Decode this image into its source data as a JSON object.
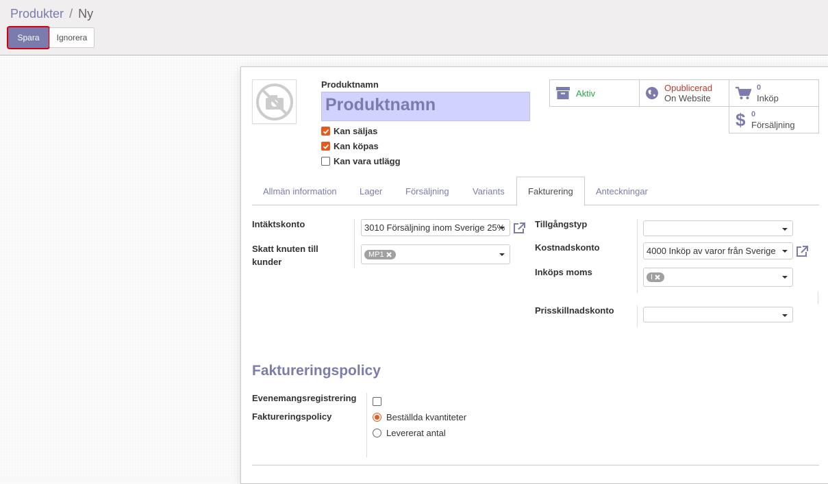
{
  "breadcrumb": {
    "parent": "Produkter",
    "separator": "/",
    "current": "Ny"
  },
  "toolbar": {
    "save_label": "Spara",
    "discard_label": "Ignorera"
  },
  "product": {
    "name_label": "Produktnamn",
    "name_placeholder": "Produktnamn",
    "checks": [
      {
        "label": "Kan säljas",
        "checked": true
      },
      {
        "label": "Kan köpas",
        "checked": true
      },
      {
        "label": "Kan vara utlägg",
        "checked": false
      }
    ]
  },
  "stat_buttons": {
    "active": {
      "label": "Aktiv",
      "icon": "archive-icon",
      "color": "#28a745"
    },
    "website": {
      "line1": "Opublicerad",
      "line2": "On Website",
      "icon": "globe-icon",
      "color": "#c0392b"
    },
    "purchases": {
      "count": "0",
      "label": "Inköp",
      "icon": "cart-icon"
    },
    "sales": {
      "count": "0",
      "label": "Försäljning",
      "icon": "dollar-icon"
    }
  },
  "tabs": [
    {
      "label": "Allmän information",
      "active": false
    },
    {
      "label": "Lager",
      "active": false
    },
    {
      "label": "Försäljning",
      "active": false
    },
    {
      "label": "Variants",
      "active": false
    },
    {
      "label": "Fakturering",
      "active": true
    },
    {
      "label": "Anteckningar",
      "active": false
    }
  ],
  "invoicing": {
    "income_account_label": "Intäktskonto",
    "income_account_value": "3010 Försäljning inom Sverige 25%",
    "customer_tax_label_1": "Skatt knuten till",
    "customer_tax_label_2": "kunder",
    "customer_tax_tag": "MP1",
    "asset_type_label": "Tillgångstyp",
    "asset_type_value": "",
    "expense_account_label": "Kostnadskonto",
    "expense_account_value": "4000 Inköp av varor från Sverige",
    "purchase_tax_label": "Inköps moms",
    "purchase_tax_tag": "I",
    "price_diff_label": "Prisskillnadskonto",
    "price_diff_value": ""
  },
  "policy": {
    "title": "Faktureringspolicy",
    "event_reg_label": "Evenemangsregistrering",
    "event_reg_checked": false,
    "policy_label": "Faktureringspolicy",
    "options": [
      {
        "label": "Beställda kvantiteter",
        "checked": true
      },
      {
        "label": "Levererat antal",
        "checked": false
      }
    ]
  },
  "colors": {
    "primary": "#7c7bad",
    "checkbox": "#e9591e",
    "highlight_border": "#d6000a"
  }
}
